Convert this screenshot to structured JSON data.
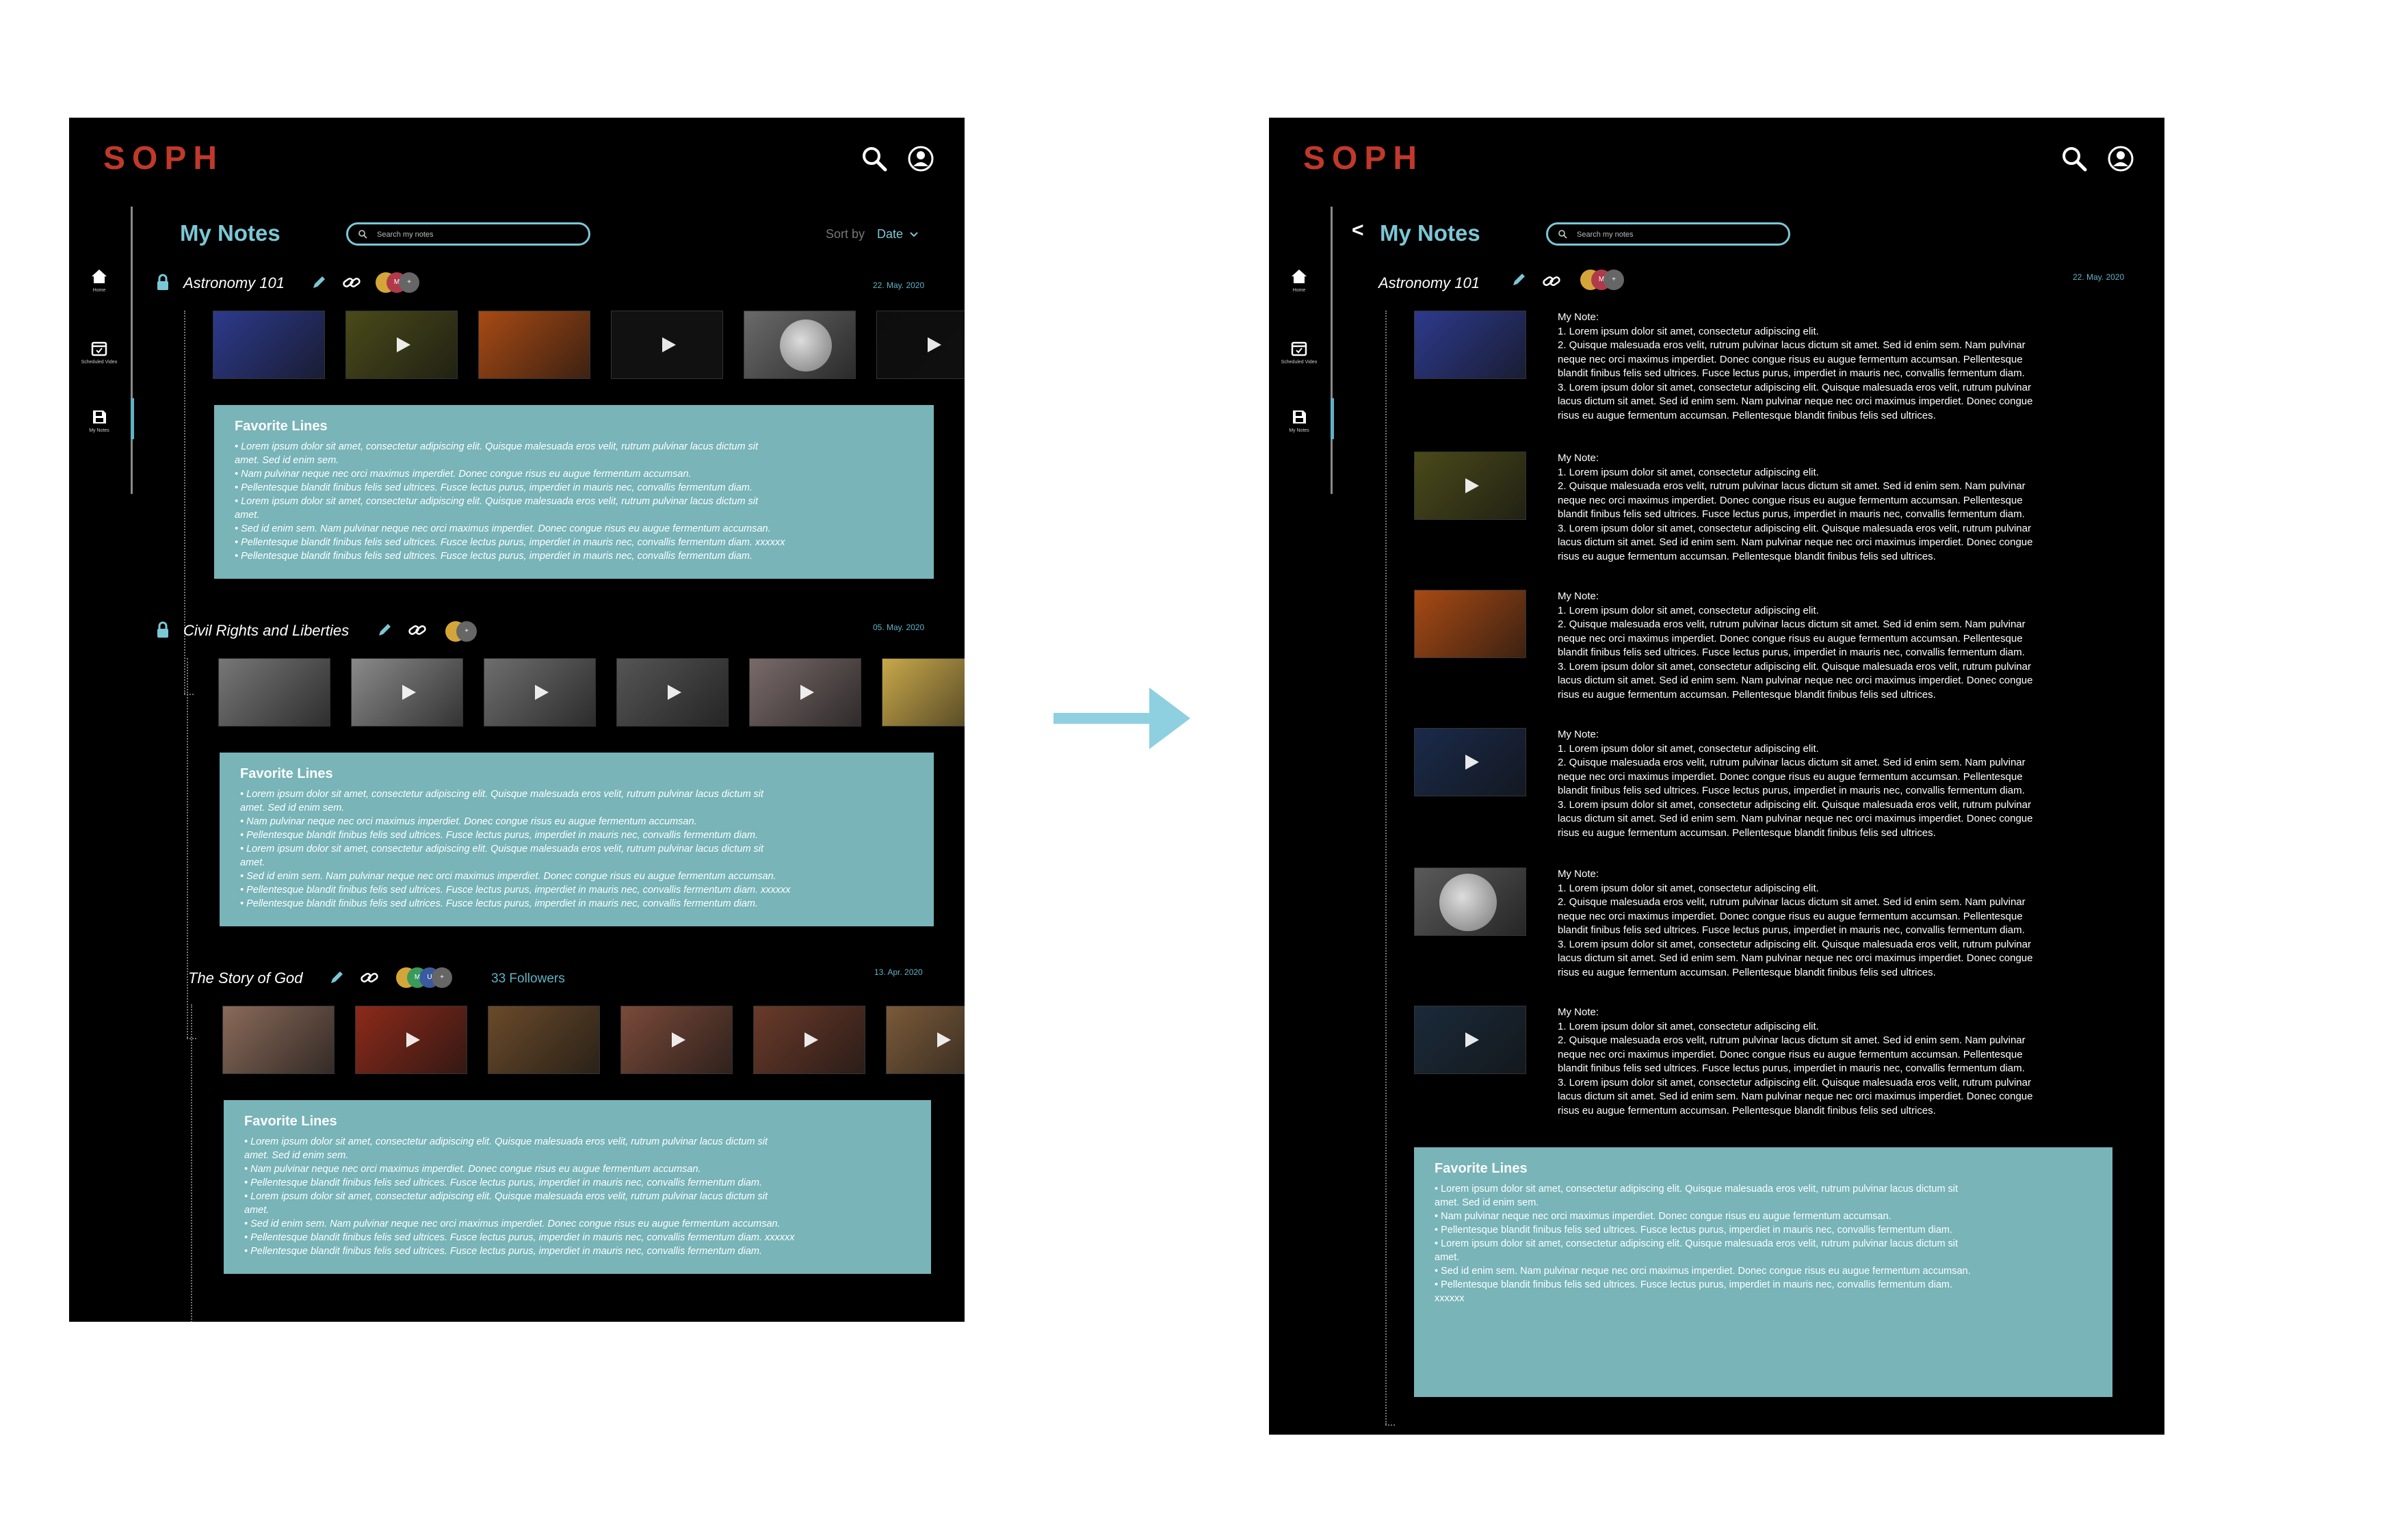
{
  "app": {
    "logo": "SOPH"
  },
  "sidebar": {
    "items": [
      {
        "label": "Home",
        "icon": "home-icon"
      },
      {
        "label": "Scheduled Video",
        "icon": "calendar-icon"
      },
      {
        "label": "My Notes",
        "icon": "save-icon"
      }
    ]
  },
  "header": {
    "title": "My Notes",
    "search_placeholder": "Search my notes",
    "sort_label": "Sort by",
    "sort_value": "Date"
  },
  "notes": [
    {
      "title": "Astronomy 101",
      "date": "22. May. 2020",
      "avatars": [
        "M",
        "+"
      ],
      "thumb_colors": [
        "#2d3a8c",
        "#4a4a1a",
        "#a84a14",
        "#111111",
        "#6a6a6a",
        "#0d0d0d"
      ]
    },
    {
      "title": "Civil Rights and Liberties",
      "date": "05. May. 2020",
      "avatars": [
        "+"
      ],
      "thumb_colors": [
        "#777777",
        "#8a8a8a",
        "#6e6e6e",
        "#555555",
        "#7a6a6a",
        "#c8a84a"
      ]
    },
    {
      "title": "The Story of God",
      "date": "13. Apr. 2020",
      "avatars": [
        "M",
        "U",
        "+"
      ],
      "followers": "33 Followers",
      "thumb_colors": [
        "#8a6a5a",
        "#8c2a1a",
        "#6a4a2a",
        "#7a4a3a",
        "#6a3a2a",
        "#7a5a3a"
      ]
    }
  ],
  "favorite": {
    "title": "Favorite Lines",
    "lines": [
      "• Lorem ipsum dolor sit amet, consectetur adipiscing elit. Quisque malesuada eros velit, rutrum pulvinar lacus dictum sit",
      "amet. Sed id enim sem.",
      "• Nam pulvinar neque nec orci maximus imperdiet. Donec congue risus eu augue fermentum accumsan.",
      "• Pellentesque blandit finibus felis sed ultrices. Fusce lectus purus, imperdiet in mauris nec, convallis fermentum diam.",
      "• Lorem ipsum dolor sit amet, consectetur adipiscing elit. Quisque malesuada eros velit, rutrum pulvinar lacus dictum sit",
      "amet.",
      "• Sed id enim sem. Nam pulvinar neque nec orci maximus imperdiet. Donec congue risus eu augue fermentum accumsan.",
      "• Pellentesque blandit finibus felis sed ultrices. Fusce lectus purus, imperdiet in mauris nec, convallis fermentum diam. xxxxxx",
      "• Pellentesque blandit finibus felis sed ultrices. Fusce lectus purus, imperdiet in mauris nec, convallis fermentum diam."
    ]
  },
  "detail": {
    "back_label": "<",
    "title": "My Notes",
    "search_placeholder": "Search my notes",
    "note_title": "Astronomy 101",
    "date": "22. May. 2020",
    "avatars": [
      "M",
      "+"
    ],
    "note_heading": "My Note:",
    "note_lines": [
      "1. Lorem ipsum dolor sit amet, consectetur adipiscing elit.",
      "2. Quisque malesuada eros velit, rutrum pulvinar lacus dictum sit amet. Sed id enim sem. Nam pulvinar",
      "neque nec orci maximus imperdiet. Donec congue risus eu augue fermentum accumsan. Pellentesque",
      "blandit finibus felis sed ultrices. Fusce lectus purus, imperdiet in mauris nec, convallis fermentum diam.",
      "3. Lorem ipsum dolor sit amet, consectetur adipiscing elit. Quisque malesuada eros velit, rutrum pulvinar",
      "lacus dictum sit amet. Sed id enim sem. Nam pulvinar neque nec orci maximus imperdiet. Donec congue",
      "risus eu augue fermentum accumsan. Pellentesque blandit finibus felis sed ultrices."
    ],
    "thumb_colors": [
      "#2d3a8c",
      "#4a4a1a",
      "#a84a14",
      "#1a2a4a",
      "#5a5a5a",
      "#1a2a3a"
    ],
    "favorite_title": "Favorite Lines",
    "favorite_lines": [
      "• Lorem ipsum dolor sit amet, consectetur adipiscing elit. Quisque malesuada eros velit, rutrum pulvinar lacus dictum sit",
      "amet. Sed id enim sem.",
      "• Nam pulvinar neque nec orci maximus imperdiet. Donec congue risus eu augue fermentum accumsan.",
      "• Pellentesque blandit finibus felis sed ultrices. Fusce lectus purus, imperdiet in mauris nec, convallis fermentum diam.",
      "• Lorem ipsum dolor sit amet, consectetur adipiscing elit. Quisque malesuada eros velit, rutrum pulvinar lacus dictum sit",
      "amet.",
      "• Sed id enim sem. Nam pulvinar neque nec orci maximus imperdiet. Donec congue risus eu augue fermentum accumsan.",
      "• Pellentesque blandit finibus felis sed ultrices. Fusce lectus purus, imperdiet in mauris nec, convallis fermentum diam.",
      "xxxxxx"
    ]
  },
  "colors": {
    "accent": "#7cc7d5",
    "brand": "#c0392b",
    "panel": "#78b4b8",
    "background": "#000000"
  }
}
